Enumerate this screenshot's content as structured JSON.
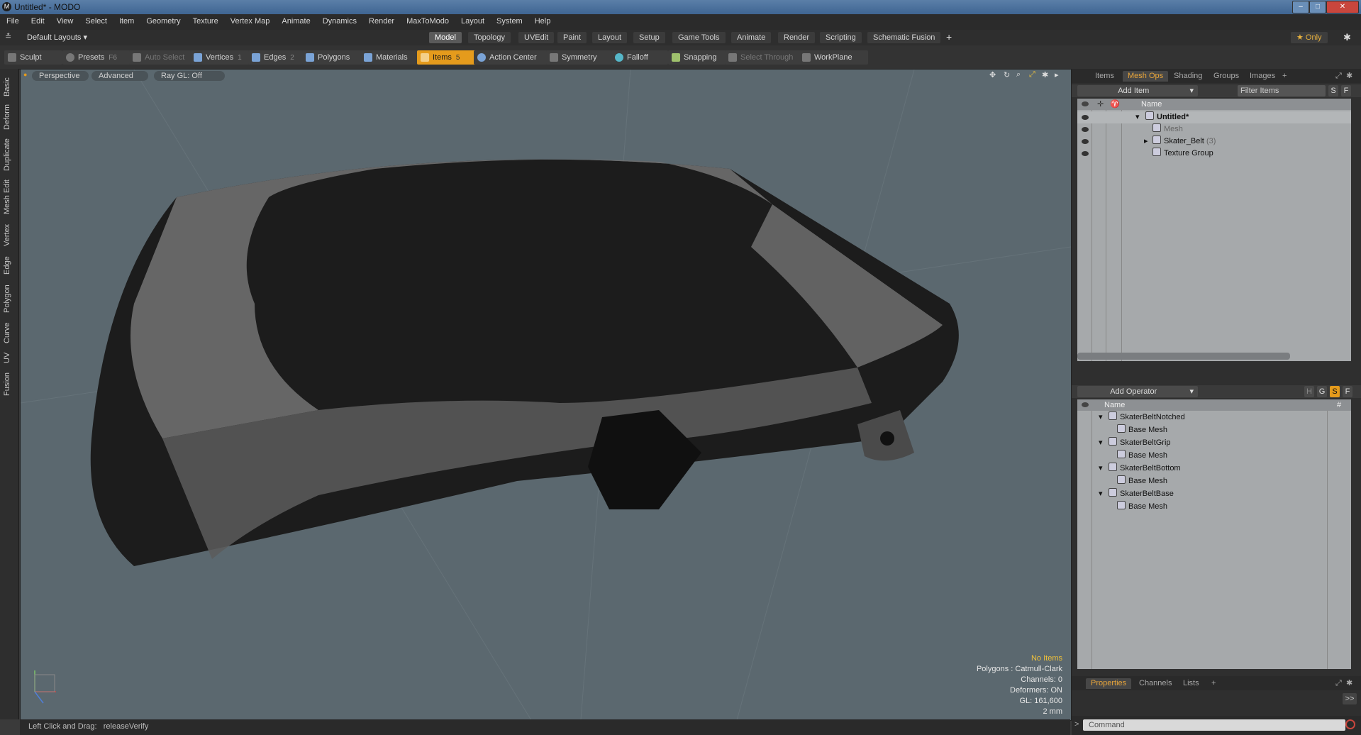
{
  "window": {
    "title": "Untitled* - MODO",
    "logo": "M"
  },
  "menu": [
    "File",
    "Edit",
    "View",
    "Select",
    "Item",
    "Geometry",
    "Texture",
    "Vertex Map",
    "Animate",
    "Dynamics",
    "Render",
    "MaxToModo",
    "Layout",
    "System",
    "Help"
  ],
  "layout_selector": "Default Layouts ▾",
  "layout_tabs": [
    "Model",
    "Topology",
    "UVEdit",
    "Paint",
    "Layout",
    "Setup",
    "Game Tools",
    "Animate",
    "Render",
    "Scripting",
    "Schematic Fusion"
  ],
  "layout_add": "+",
  "only_label": "★ Only",
  "toolbar": {
    "sculpt": "Sculpt",
    "presets": "Presets",
    "presets_key": "F6",
    "auto_select": "Auto Select",
    "vertices": "Vertices",
    "vertices_key": "1",
    "edges": "Edges",
    "edges_key": "2",
    "polygons": "Polygons",
    "materials": "Materials",
    "items": "Items",
    "items_key": "5",
    "action_center": "Action Center",
    "symmetry": "Symmetry",
    "falloff": "Falloff",
    "snapping": "Snapping",
    "select_through": "Select Through",
    "workplane": "WorkPlane"
  },
  "left_tabs": [
    "Basic",
    "Deform",
    "Duplicate",
    "Mesh Edit",
    "Vertex",
    "Edge",
    "Polygon",
    "Curve",
    "UV",
    "Fusion"
  ],
  "viewport": {
    "perspective": "Perspective",
    "advanced": "Advanced",
    "raygl": "Ray GL: Off",
    "info": {
      "no_items": "No Items",
      "polygons": "Polygons : Catmull-Clark",
      "channels": "Channels: 0",
      "deformers": "Deformers: ON",
      "gl": "GL: 161,600",
      "scale": "2 mm"
    }
  },
  "status": "Left Click and Drag:   releaseVerify",
  "items_panel": {
    "tabs": [
      "Items",
      "Mesh Ops",
      "Shading",
      "Groups",
      "Images"
    ],
    "add_item": "Add Item",
    "filter": "Filter Items",
    "btn_s": "S",
    "btn_f": "F",
    "header_name": "Name",
    "rows": [
      {
        "label": "Untitled*",
        "indent": 0,
        "bold": true
      },
      {
        "label": "Mesh",
        "indent": 1,
        "dim": true
      },
      {
        "label": "Skater_Belt",
        "count": "(3)",
        "indent": 1
      },
      {
        "label": "Texture Group",
        "indent": 1
      }
    ]
  },
  "meshops_panel": {
    "add_operator": "Add Operator",
    "btn_h": "H",
    "btn_g": "G",
    "btn_s": "S",
    "btn_f": "F",
    "header_name": "Name",
    "header_hash": "#",
    "rows": [
      {
        "label": "SkaterBeltNotched",
        "indent": 0
      },
      {
        "label": "Base Mesh",
        "indent": 1
      },
      {
        "label": "SkaterBeltGrip",
        "indent": 0
      },
      {
        "label": "Base Mesh",
        "indent": 1
      },
      {
        "label": "SkaterBeltBottom",
        "indent": 0
      },
      {
        "label": "Base Mesh",
        "indent": 1
      },
      {
        "label": "SkaterBeltBase",
        "indent": 0
      },
      {
        "label": "Base Mesh",
        "indent": 1
      }
    ]
  },
  "props_panel": {
    "tabs": [
      "Properties",
      "Channels",
      "Lists"
    ],
    "more": ">>"
  },
  "command": {
    "placeholder": "Command",
    "prompt": ">"
  },
  "colors": {
    "accent": "#e59b1c",
    "viewport_bg": "#5b686f",
    "list_bg": "#a6a9ab"
  }
}
